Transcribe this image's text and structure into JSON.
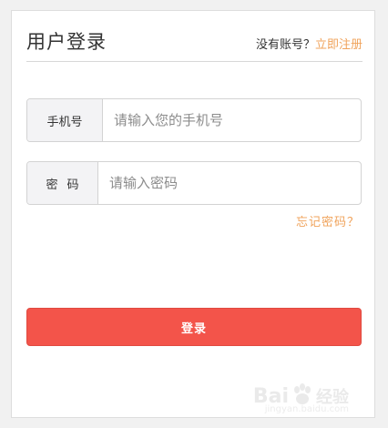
{
  "login": {
    "title": "用户登录",
    "no_account_text": "没有账号？",
    "register_link": "立即注册",
    "phone_label": "手机号",
    "phone_placeholder": "请输入您的手机号",
    "phone_value": "",
    "password_label": "密码",
    "password_placeholder": "请输入密码",
    "password_value": "",
    "forgot_password": "忘记密码？",
    "login_button": "登录"
  },
  "watermark": {
    "brand": "Bai",
    "brand_cn": "经验",
    "url": "jingyan.baidu.com"
  },
  "colors": {
    "accent_link": "#f0a35b",
    "button": "#f3544a",
    "background": "#f1f1f1"
  }
}
